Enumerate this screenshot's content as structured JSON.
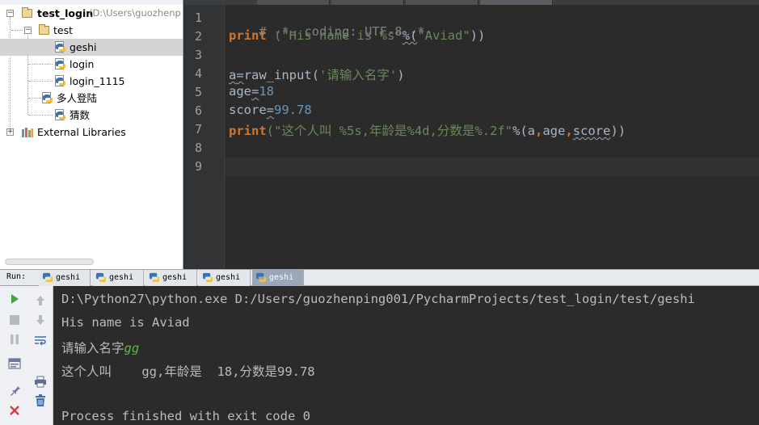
{
  "project_tree": {
    "root": {
      "name": "test_login",
      "path_hint": "(D:\\Users\\guozhenp"
    },
    "folder": {
      "name": "test"
    },
    "files": [
      {
        "name": "geshi",
        "selected": true
      },
      {
        "name": "login",
        "selected": false
      },
      {
        "name": "login_1115",
        "selected": false
      },
      {
        "name": "多人登陆",
        "selected": false
      },
      {
        "name": "猜数",
        "selected": false
      }
    ],
    "external_libraries": "External Libraries"
  },
  "editor": {
    "line_numbers": [
      "1",
      "2",
      "3",
      "4",
      "5",
      "6",
      "7",
      "8",
      "9"
    ],
    "current_line": "9",
    "lines": {
      "l1": {
        "comment": "# -*- coding: UTF-8 -*-"
      },
      "l2": {
        "kw": "print",
        "sp": " ",
        "str": "(\"His name is %s\"",
        "op": "%(",
        "arg": "\"Aviad\"",
        "close": "))"
      },
      "l4": {
        "var": "a",
        "eq": "=",
        "fn": "raw_input",
        "open": "(",
        "str": "'请输入名字'",
        "close": ")"
      },
      "l5": {
        "var": "age",
        "eq": "=",
        "num": "18"
      },
      "l6": {
        "var": "score",
        "eq": "=",
        "num": "99.78"
      },
      "l7": {
        "kw": "print",
        "str": "(\"这个人叫 %5s,年龄是%4d,分数是%.2f\"",
        "op": "%(",
        "a": "a",
        "c1": ",",
        "age": "age",
        "c2": ",",
        "score": "score",
        "close": "))"
      }
    }
  },
  "run": {
    "label": "Run:",
    "tabs": [
      {
        "name": "geshi",
        "active": false
      },
      {
        "name": "geshi",
        "active": false
      },
      {
        "name": "geshi",
        "active": false
      },
      {
        "name": "geshi",
        "active": false
      },
      {
        "name": "geshi",
        "active": true
      }
    ],
    "toolbar_icons": [
      "rerun-icon",
      "scroll-up-icon",
      "stop-icon",
      "scroll-down-icon",
      "pause-icon",
      "soft-wrap-icon",
      "restore-layout-icon",
      "print-icon",
      "pin-icon",
      "clear-all-icon",
      "close-icon"
    ]
  },
  "console": {
    "command": "D:\\Python27\\python.exe D:/Users/guozhenping001/PycharmProjects/test_login/test/geshi",
    "out1": "His name is Aviad",
    "prompt": "请输入名字",
    "user_input": "gg",
    "out2": "这个人叫    gg,年龄是  18,分数是99.78",
    "blank": "",
    "exit": "Process finished with exit code 0"
  },
  "colors": {
    "editor_bg": "#2b2b2b",
    "keyword": "#cc7832",
    "string": "#6a8759",
    "number": "#6897bb",
    "comment": "#808080",
    "console_input": "#62b543",
    "run_tab_active": "#9aa7b9"
  }
}
